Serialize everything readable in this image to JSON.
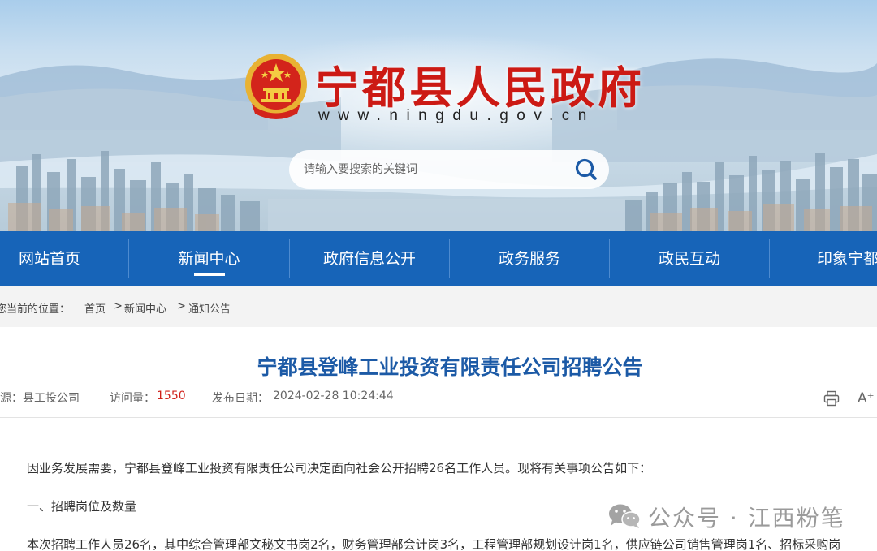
{
  "header": {
    "title": "宁都县人民政府",
    "url": "www.ningdu.gov.cn",
    "search_placeholder": "请输入要搜索的关键词",
    "emblem_icon": "national-emblem-icon",
    "search_icon": "search-icon"
  },
  "nav": {
    "items": [
      {
        "label": "网站首页"
      },
      {
        "label": "新闻中心",
        "active": true
      },
      {
        "label": "政府信息公开"
      },
      {
        "label": "政务服务"
      },
      {
        "label": "政民互动"
      },
      {
        "label": "印象宁都"
      }
    ]
  },
  "breadcrumb": {
    "prefix": "您当前的位置：",
    "items": [
      "首页",
      "新闻中心",
      "通知公告"
    ],
    "separator": ">"
  },
  "article": {
    "title": "宁都县登峰工业投资有限责任公司招聘公告",
    "source_label": "来源：",
    "source_value": "县工投公司",
    "views_label": "访问量：",
    "views_value": "1550",
    "date_label": "发布日期：",
    "date_value": "2024-02-28 10:24:44",
    "print_icon": "print-icon",
    "font_size_icon": "font-size-icon",
    "font_size_label": "A⁺",
    "paragraphs": [
      "因业务发展需要，宁都县登峰工业投资有限责任公司决定面向社会公开招聘26名工作人员。现将有关事项公告如下：",
      "一、招聘岗位及数量",
      "本次招聘工作人员26名，其中综合管理部文秘文书岗2名，财务管理部会计岗3名，工程管理部规划设计岗1名，供应链公司销售管理岗1名、招标采购岗"
    ]
  },
  "watermark": {
    "text": "公众号 · 江西粉笔",
    "icon": "wechat-icon"
  },
  "colors": {
    "brand_red": "#cc1a14",
    "nav_blue": "#1764b8",
    "title_blue": "#1c5aa6",
    "views_red": "#d0211a"
  }
}
